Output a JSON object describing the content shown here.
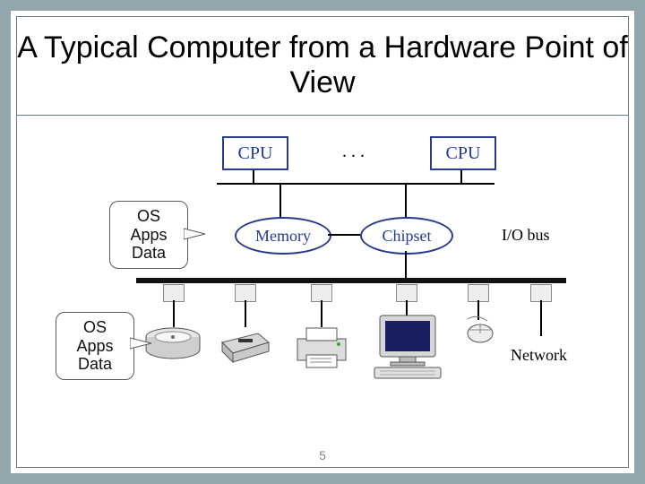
{
  "title": "A Typical Computer from a Hardware Point of View",
  "page_number": "5",
  "nodes": {
    "cpu_left": "CPU",
    "cpu_right": "CPU",
    "ellipsis": ". . .",
    "memory": "Memory",
    "chipset": "Chipset",
    "io_bus_label": "I/O bus",
    "network_label": "Network"
  },
  "callouts": {
    "memory": "OS\nApps\nData",
    "disk": "OS\nApps\nData"
  },
  "devices": [
    {
      "name": "hard-disk"
    },
    {
      "name": "floppy-drive"
    },
    {
      "name": "printer"
    },
    {
      "name": "monitor-keyboard"
    },
    {
      "name": "mouse"
    },
    {
      "name": "network"
    }
  ]
}
